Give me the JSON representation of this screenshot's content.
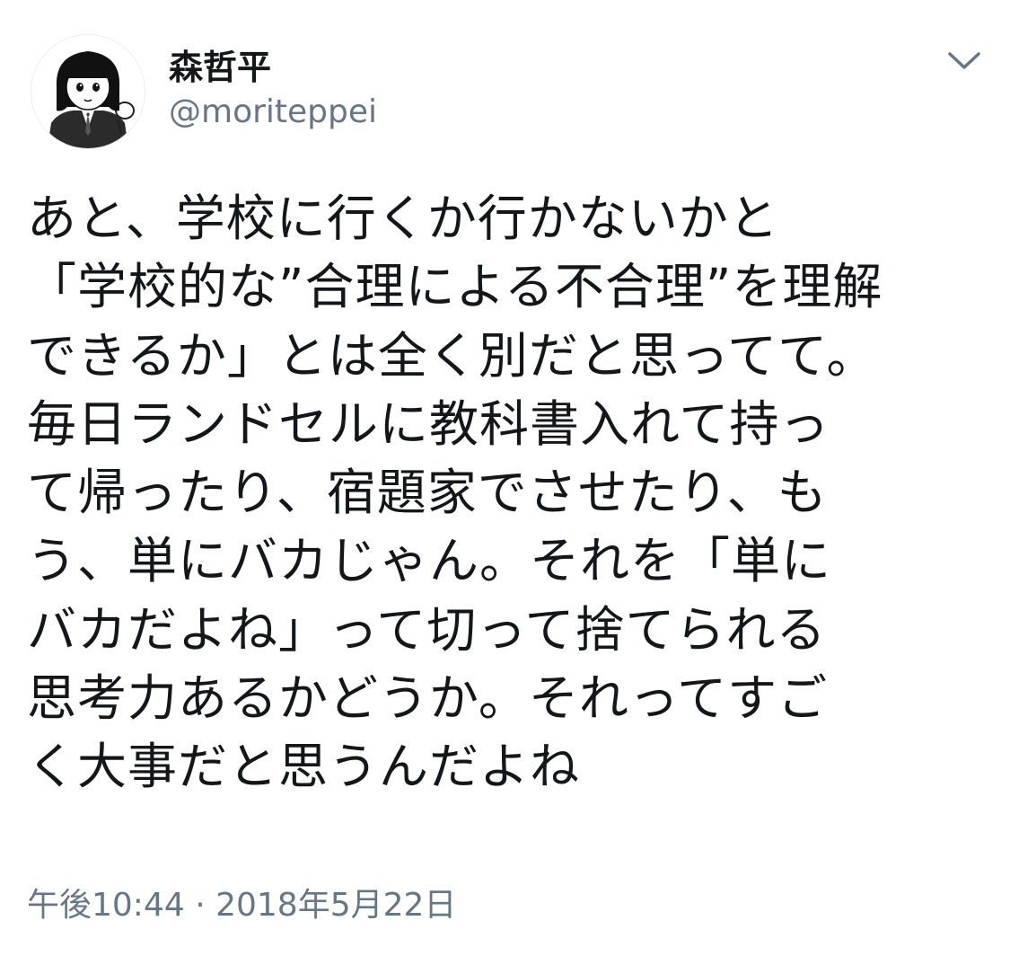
{
  "tweet": {
    "display_name": "森哲平",
    "handle": "@moriteppei",
    "text_lines": [
      "あと、学校に行くか行かないかと",
      "「学校的な”合理による不合理”を理解",
      "できるか」とは全く別だと思ってて。",
      "毎日ランドセルに教科書入れて持っ",
      "て帰ったり、宿題家でさせたり、も",
      "う、単にバカじゃん。それを「単に",
      "バカだよね」って切って捨てられる",
      "思考力あるかどうか。それってすご",
      "く大事だと思うんだよね"
    ],
    "timestamp": "午後10:44 · 2018年5月22日"
  },
  "icons": {
    "menu": "chevron-down-icon"
  },
  "colors": {
    "text": "#14171a",
    "secondary": "#657786",
    "background": "#ffffff"
  }
}
